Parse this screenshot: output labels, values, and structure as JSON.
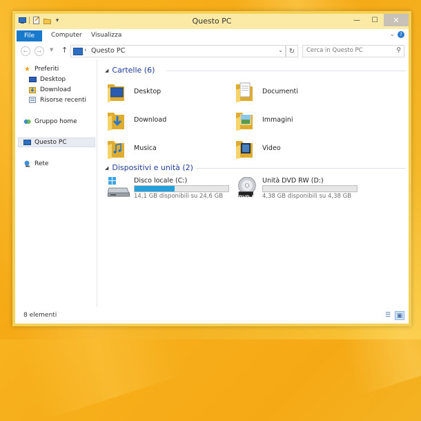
{
  "window": {
    "title": "Questo PC"
  },
  "ribbon": {
    "tabs": [
      {
        "label": "File",
        "active": true
      },
      {
        "label": "Computer"
      },
      {
        "label": "Visualizza"
      }
    ],
    "help_label": "?"
  },
  "window_controls": {
    "minimize": "—",
    "maximize": "☐",
    "close": "✕"
  },
  "navigation": {
    "back_icon": "arrow-left-icon",
    "forward_icon": "arrow-right-icon",
    "up_label": "↑",
    "address": {
      "separator": "›",
      "crumb": "Questo PC"
    },
    "search_placeholder": "Cerca in Questo PC"
  },
  "sidebar": {
    "items": [
      {
        "id": "preferiti",
        "label": "Preferiti",
        "icon": "star-icon"
      },
      {
        "id": "desktop",
        "label": "Desktop",
        "icon": "desktop-icon"
      },
      {
        "id": "download",
        "label": "Download",
        "icon": "download-folder-icon"
      },
      {
        "id": "risorse-recenti",
        "label": "Risorse recenti",
        "icon": "recent-places-icon"
      },
      {
        "id": "gruppo-home",
        "label": "Gruppo home",
        "icon": "homegroup-icon"
      },
      {
        "id": "questo-pc",
        "label": "Questo PC",
        "icon": "computer-icon",
        "selected": true
      },
      {
        "id": "rete",
        "label": "Rete",
        "icon": "network-icon"
      }
    ]
  },
  "content": {
    "folders_header": "Cartelle (6)",
    "folders": [
      {
        "label": "Desktop",
        "icon": "desktop-folder-icon"
      },
      {
        "label": "Documenti",
        "icon": "documents-folder-icon"
      },
      {
        "label": "Download",
        "icon": "download-folder-icon"
      },
      {
        "label": "Immagini",
        "icon": "pictures-folder-icon"
      },
      {
        "label": "Musica",
        "icon": "music-folder-icon"
      },
      {
        "label": "Video",
        "icon": "video-folder-icon"
      }
    ],
    "devices_header": "Dispositivi e unità (2)",
    "devices": [
      {
        "name": "Disco locale (C:)",
        "info": "14,1 GB disponibili su 24,6 GB",
        "used_fraction": 0.43,
        "icon": "local-disk-icon"
      },
      {
        "name": "Unità DVD RW (D:)",
        "info": "4,38 GB disponibili su 4,38 GB",
        "used_fraction": 0.0,
        "icon": "dvd-drive-icon",
        "badge": "DVD-R"
      }
    ]
  },
  "status": {
    "count": "8 elementi"
  },
  "colors": {
    "accent": "#1979ca",
    "group_header": "#1e3c9a",
    "usage_bar": "#26a0da",
    "folder_yellow": "#f2c54c"
  }
}
